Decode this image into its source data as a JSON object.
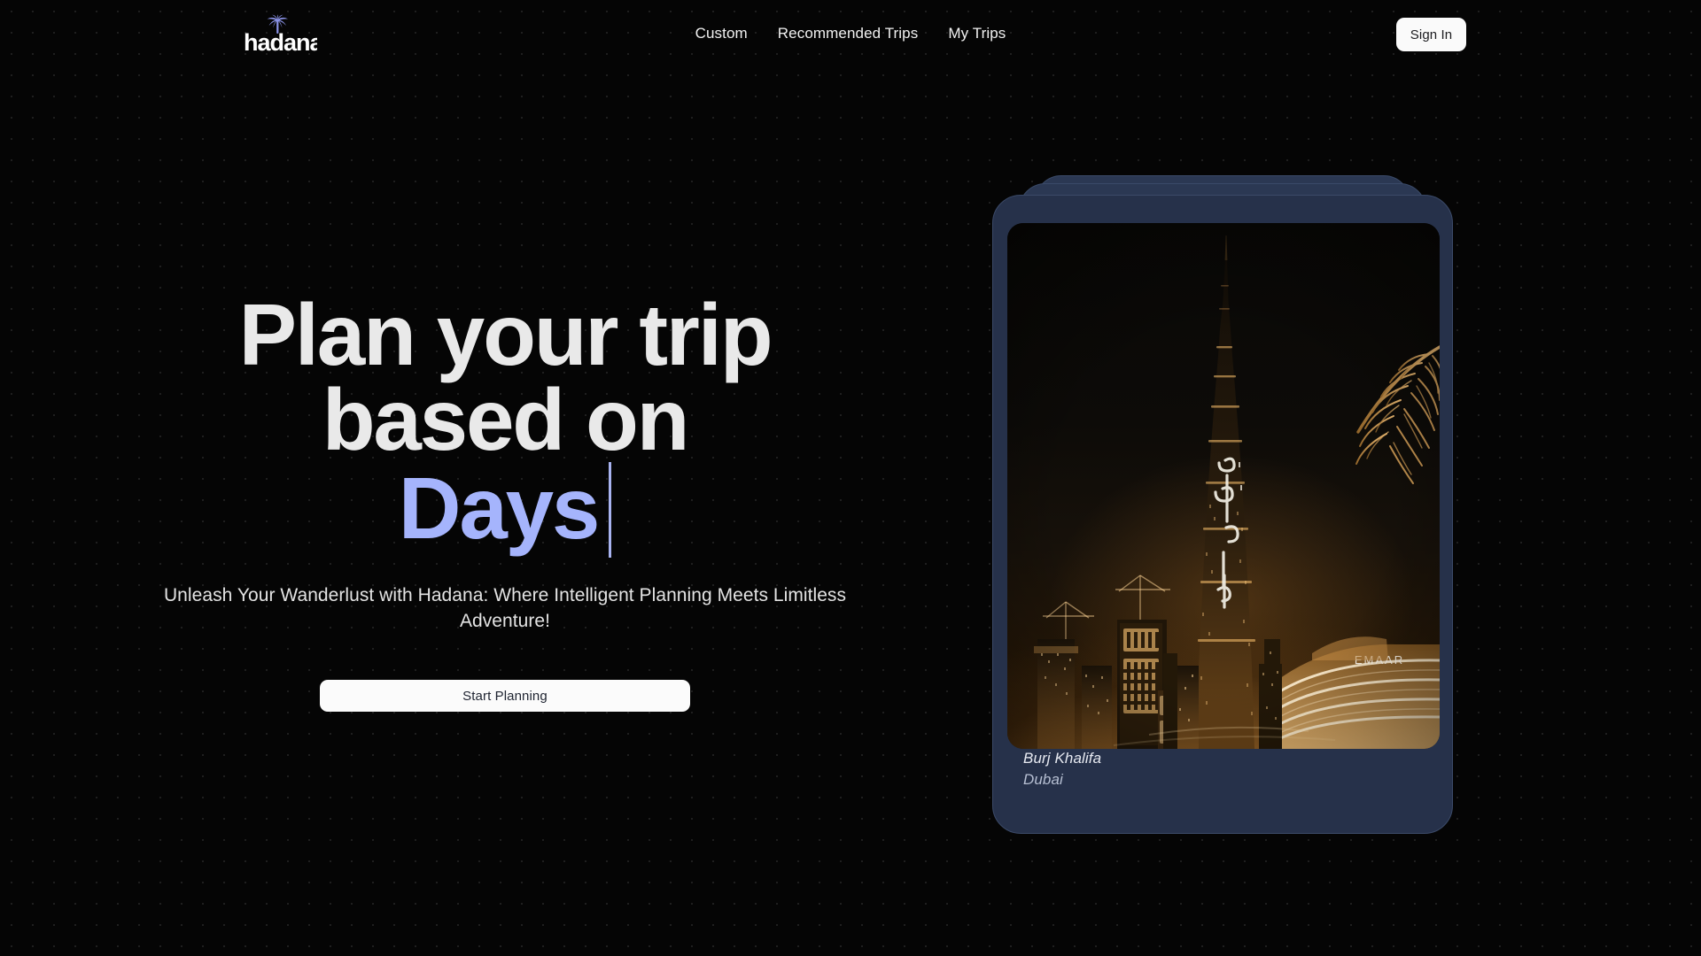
{
  "brand": {
    "name": "hadana",
    "icon": "palm-tree-icon",
    "logo_text_color": "#ffffff",
    "logo_icon_color": "#8b93e8"
  },
  "header": {
    "nav": [
      {
        "label": "Custom"
      },
      {
        "label": "Recommended Trips"
      },
      {
        "label": "My Trips"
      }
    ],
    "sign_in_label": "Sign In"
  },
  "hero": {
    "headline_line1": "Plan your trip",
    "headline_line2": "based on",
    "headline_accent": "Days",
    "accent_color": "#a5b4fc",
    "subtitle": "Unleash Your Wanderlust with Hadana: Where Intelligent Planning Meets Limitless Adventure!",
    "cta_label": "Start Planning"
  },
  "destination_card": {
    "title": "Burj Khalifa",
    "location": "Dubai",
    "photo_alt": "Burj Khalifa illuminated at night above the golden-lit Downtown Dubai skyline with a palm frond in the foreground",
    "photo_sign_text": "EMAAR",
    "card_color": "#26314a",
    "card_border_color": "#3b4a68"
  },
  "background": {
    "color": "#050505",
    "dot_color": "#1f1f1f",
    "dot_spacing_px": 24
  }
}
